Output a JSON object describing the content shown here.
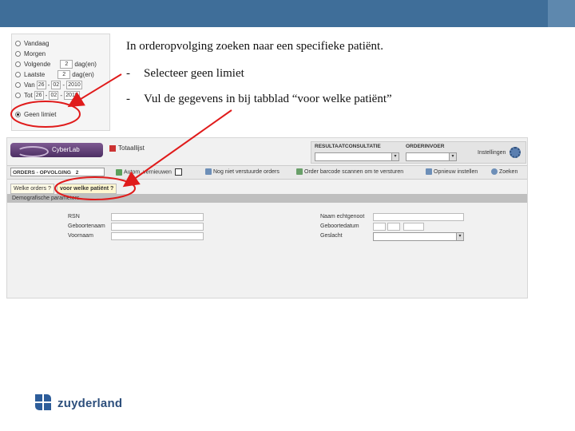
{
  "filter_panel": {
    "rows": [
      {
        "label": "Vandaag"
      },
      {
        "label": "Morgen"
      },
      {
        "label": "Volgende",
        "value": "2",
        "unit": "dag(en)"
      },
      {
        "label": "Laatste",
        "value": "2",
        "unit": "dag(en)"
      },
      {
        "label": "Van",
        "day": "26",
        "month": "02",
        "year": "2010"
      },
      {
        "label": "Tot",
        "day": "26",
        "month": "02",
        "year": "2010"
      },
      {
        "label": "Geen limiet",
        "checked": true
      }
    ]
  },
  "instructions": {
    "heading": "In orderopvolging zoeken naar een specifieke patiënt.",
    "bullets": [
      {
        "dash": "-",
        "text": "Selecteer geen limiet"
      },
      {
        "dash": "-",
        "text": "Vul de gegevens in bij tabblad “voor welke patiënt”"
      }
    ]
  },
  "app": {
    "logo_text": "CyberLab",
    "totaal_label": "Totaallijst",
    "top_tabs": {
      "resultaat": "RESULTAATCONSULTATIE",
      "orderinvoer": "ORDERINVOER",
      "instellingen": "Instellingen"
    },
    "orders_dropdown": "ORDERS - OPVOLGING",
    "orders_count": "2",
    "nav_buttons": {
      "vernieuwen": "Autom. vernieuwen",
      "nog_niet": "Nog niet verstuurde orders",
      "barcode": "Order barcode scannen om te versturen",
      "opnieuw": "Opnieuw instellen",
      "zoeken": "Zoeken"
    },
    "subtabs": {
      "welke_orders": "Welke orders ?",
      "welke_patient": "voor welke patiënt ?"
    },
    "section_title": "Demografische parameters",
    "fields_left": {
      "ssn": "RSN",
      "geboortenaam": "Geboortenaam",
      "voornaam": "Voornaam"
    },
    "fields_right": {
      "naam_echtgenoot": "Naam echtgenoot",
      "geboortedatum": "Geboortedatum",
      "geslacht": "Geslacht"
    }
  },
  "brand": {
    "name": "zuyderland",
    "color": "#2d5d9a"
  },
  "colors": {
    "header": "#3f6e99",
    "annotation": "#e01b1b"
  }
}
